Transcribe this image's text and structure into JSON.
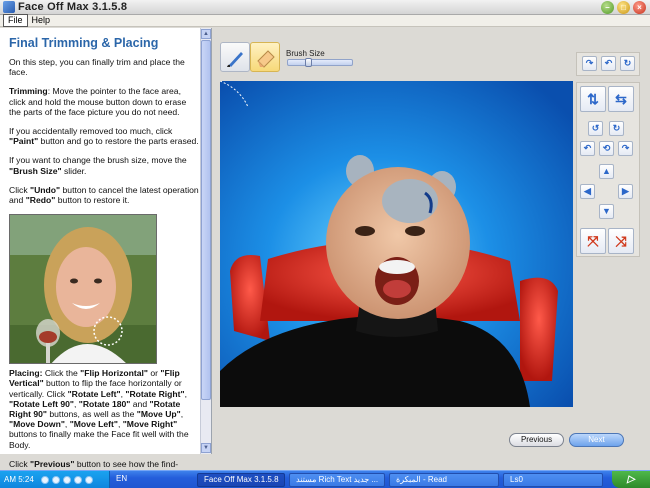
{
  "window": {
    "title": "Face Off Max  3.1.5.8"
  },
  "menu": {
    "file": "File",
    "help": "Help"
  },
  "help": {
    "title": "Final Trimming & Placing",
    "intro": "On this step, you can finally trim and place the face.",
    "trimming_label": "Trimming",
    "trimming_text": ": Move the pointer to the face area, click and hold the mouse button down to erase the parts of the face picture you do not need.",
    "removed_pre": "If you accidentally removed too much, click ",
    "removed_btn": "\"Paint\"",
    "removed_post": " button and go to restore the parts erased.",
    "brush_pre": "If you want to change the brush size, move the ",
    "brush_btn": "\"Brush Size\"",
    "brush_post": " slider.",
    "undo_pre": "Click ",
    "undo_btn": "\"Undo\"",
    "undo_mid": " button to cancel the latest operation and ",
    "redo_btn": "\"Redo\"",
    "redo_post": " button to restore it.",
    "placing_label": "Placing:",
    "placing_1": " Click the ",
    "flip_h": "\"Flip Horizontal\"",
    "placing_2": " or ",
    "flip_v": "\"Flip Vertical\"",
    "placing_3": " button to flip the face horizontally or vertically. Click ",
    "rot_left": "\"Rotate Left\"",
    "comma1": ", ",
    "rot_right": "\"Rotate Right\"",
    "comma2": ", ",
    "rot_left90": "\"Rotate Left 90\"",
    "comma3": ", ",
    "rot_180": "\"Rotate 180\"",
    "and1": " and ",
    "rot_right90": "\"Rotate Right 90\"",
    "placing_4": " buttons, as well as the ",
    "move_up": "\"Move Up\"",
    "comma4": ", ",
    "move_down": "\"Move Down\"",
    "comma5": ", ",
    "move_left": "\"Move Left\"",
    "comma6": ", ",
    "move_right": "\"Move Right\"",
    "placing_5": " buttons to finally make the Face fit well with the Body.",
    "prev_pre": "Click ",
    "prev_btn": "\"Previous\"",
    "prev_post": " button to see how the find-tuned face will look on the body and to make any further"
  },
  "toolbar": {
    "brush_size_label": "Brush Size",
    "brush_size_value": 0.3
  },
  "nav": {
    "previous": "Previous",
    "next": "Next"
  },
  "taskbar": {
    "clock": "AM 5:24",
    "lang": "EN",
    "task1": "Face Off Max  3.1.5.8",
    "task2": "مستند Rich Text جديد ...",
    "task3": "المبكرة - Read",
    "task4": "Ls0"
  },
  "colors": {
    "title_blue": "#2b66a9",
    "canvas_blue": "#0f67c8",
    "taskbar_blue": "#245edb",
    "next_button": "#6ea3ec"
  }
}
